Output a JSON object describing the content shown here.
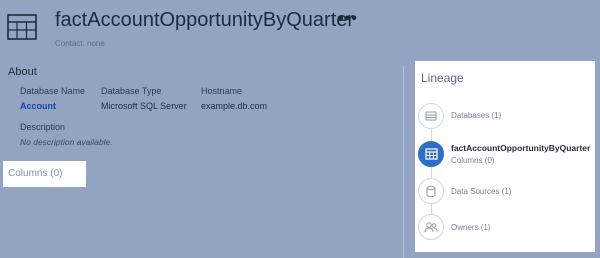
{
  "header": {
    "title": "factAccountOpportunityByQuarter",
    "more": "•••",
    "contact": "Contact: none"
  },
  "about": {
    "title": "About",
    "database_name_label": "Database Name",
    "database_name_value": "Account",
    "database_type_label": "Database Type",
    "database_type_value": "Microsoft SQL Server",
    "hostname_label": "Hostname",
    "hostname_value": "example.db.com",
    "description_label": "Description",
    "description_value": "No description available."
  },
  "columns": {
    "label": "Columns (0)"
  },
  "lineage": {
    "title": "Lineage",
    "items": [
      {
        "label": "Databases (1)",
        "icon": "database-icon",
        "active": false
      },
      {
        "label": "factAccountOpportunityByQuarter",
        "sub": "Columns (0)",
        "icon": "table-icon",
        "active": true
      },
      {
        "label": "Data Sources (1)",
        "icon": "datasource-icon",
        "active": false
      },
      {
        "label": "Owners (1)",
        "icon": "owners-icon",
        "active": false
      }
    ]
  },
  "colors": {
    "background": "#93a4c3",
    "accent": "#2f6ec8",
    "link": "#1c46a8"
  }
}
